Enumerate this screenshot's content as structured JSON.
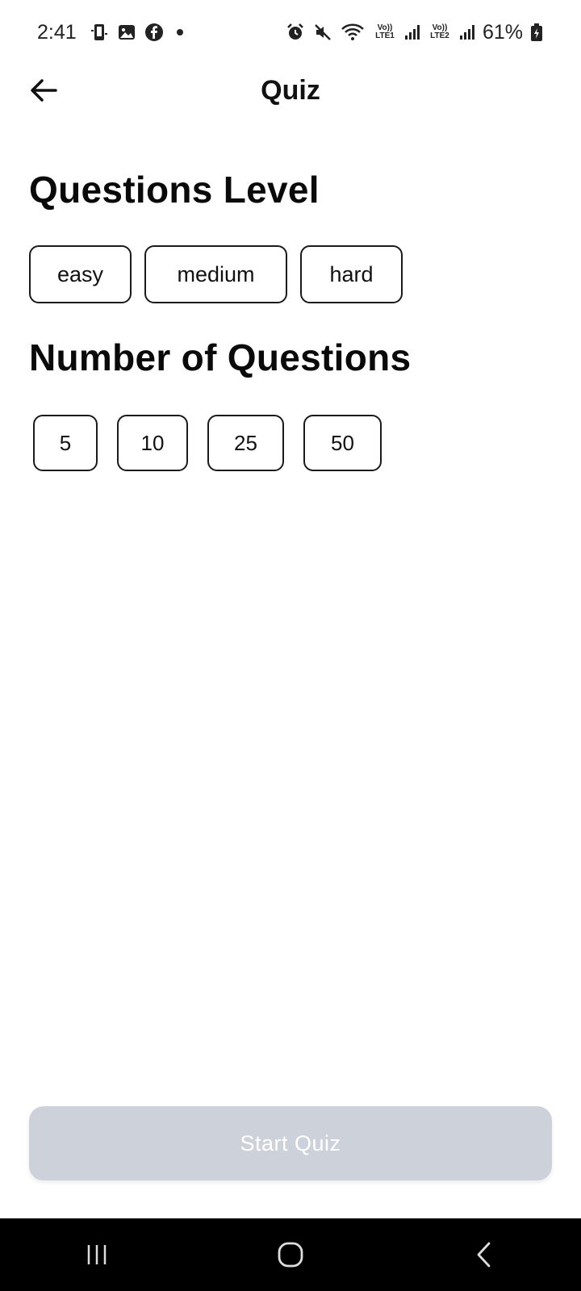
{
  "status_bar": {
    "time": "2:41",
    "battery_percent": "61%",
    "net1_label": "Vo)) LTE1",
    "net2_label": "Vo)) LTE2",
    "icons": [
      "phone-sync-icon",
      "gallery-icon",
      "facebook-icon",
      "notification-dot",
      "alarm-icon",
      "mute-icon",
      "wifi-icon",
      "signal-icon",
      "signal-icon",
      "battery-charging-icon"
    ]
  },
  "app_bar": {
    "title": "Quiz",
    "back_icon": "arrow-left-icon"
  },
  "level_section": {
    "title": "Questions Level",
    "options": [
      "easy",
      "medium",
      "hard"
    ]
  },
  "count_section": {
    "title": "Number of Questions",
    "options": [
      "5",
      "10",
      "25",
      "50"
    ]
  },
  "start_button": {
    "label": "Start Quiz",
    "background": "#cdd1da",
    "text_color": "#ffffff"
  },
  "nav_bar": {
    "icons": [
      "recent-apps-icon",
      "home-icon",
      "back-icon"
    ]
  }
}
